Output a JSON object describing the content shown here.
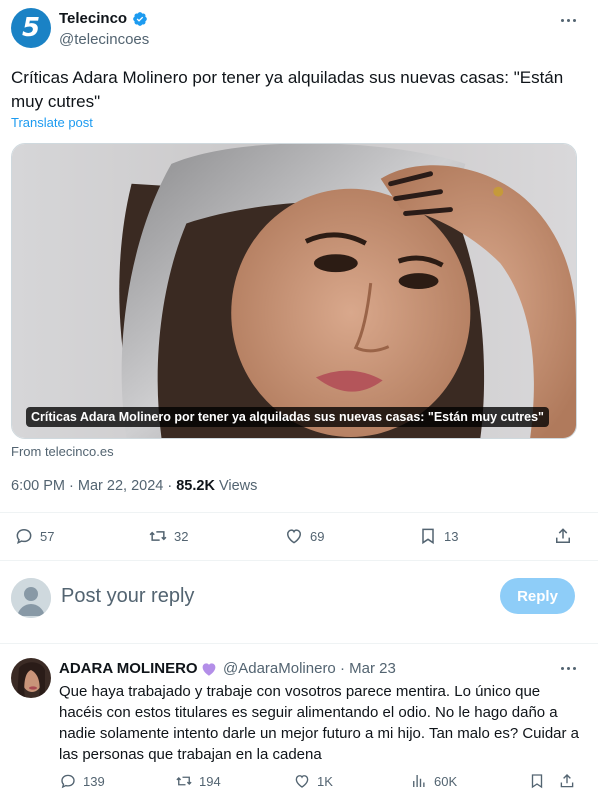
{
  "post": {
    "author_name": "Telecinco",
    "author_handle": "@telecincoes",
    "avatar_text": "5",
    "text": "Críticas Adara Molinero por tener ya alquiladas sus nuevas casas: \"Están muy cutres\"",
    "translate_label": "Translate post",
    "card_caption": "Críticas Adara Molinero por tener ya alquiladas sus nuevas casas: \"Están muy cutres\"",
    "card_source": "From telecinco.es",
    "time": "6:00 PM · Mar 22, 2024 · ",
    "views_count": "85.2K",
    "views_label": " Views",
    "stats": {
      "replies": "57",
      "reposts": "32",
      "likes": "69",
      "bookmarks": "13"
    }
  },
  "composer": {
    "placeholder": "Post your reply",
    "button_label": "Reply"
  },
  "reply": {
    "author_name": "ADARA MOLINERO",
    "author_handle": "@AdaraMolinero · Mar 23",
    "text": "Que haya trabajado y trabaje con vosotros parece mentira. Lo único que hacéis con estos titulares es seguir alimentando el odio. No le hago daño a nadie solamente intento darle un mejor futuro a mi hijo. Tan malo es? Cuidar a las personas que trabajan en la cadena",
    "stats": {
      "replies": "139",
      "reposts": "194",
      "likes": "1K",
      "views": "60K"
    }
  },
  "colors": {
    "accent": "#1d9bf0",
    "reply_button": "#8ecdf8",
    "muted_text": "#536471",
    "brand_avatar": "#1a82c5",
    "heart_emoji": "#b38ee8"
  },
  "icons": {
    "verified": "verified-badge-icon",
    "more": "more-dots-icon",
    "reply": "comment-icon",
    "repost": "repost-icon",
    "like": "heart-icon",
    "bookmark": "bookmark-icon",
    "share": "share-icon",
    "views": "analytics-icon"
  }
}
